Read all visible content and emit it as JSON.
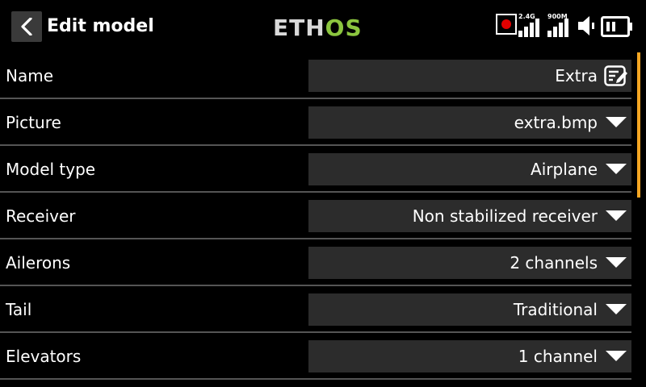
{
  "header": {
    "title": "Edit model",
    "logo_text": "ETHOS",
    "back_icon": "chevron-left-icon",
    "status": {
      "recording_icon": "record-icon",
      "rf_2g4_label": "2.4G",
      "rf_900m_label": "900M",
      "volume_icon": "speaker-icon",
      "battery_icon": "battery-icon"
    }
  },
  "colors": {
    "background": "#000000",
    "field_bg": "#2c2c2c",
    "divider": "#555555",
    "accent_scroll": "#f5a623",
    "logo_green": "#8cc63f",
    "record_red": "#e00000"
  },
  "rows": [
    {
      "label": "Name",
      "value": "Extra",
      "control": "edit-icon"
    },
    {
      "label": "Picture",
      "value": "extra.bmp",
      "control": "dropdown-arrow-icon"
    },
    {
      "label": "Model type",
      "value": "Airplane",
      "control": "dropdown-arrow-icon"
    },
    {
      "label": "Receiver",
      "value": "Non stabilized receiver",
      "control": "dropdown-arrow-icon"
    },
    {
      "label": "Ailerons",
      "value": "2 channels",
      "control": "dropdown-arrow-icon"
    },
    {
      "label": "Tail",
      "value": "Traditional",
      "control": "dropdown-arrow-icon"
    },
    {
      "label": "Elevators",
      "value": "1 channel",
      "control": "dropdown-arrow-icon"
    }
  ]
}
